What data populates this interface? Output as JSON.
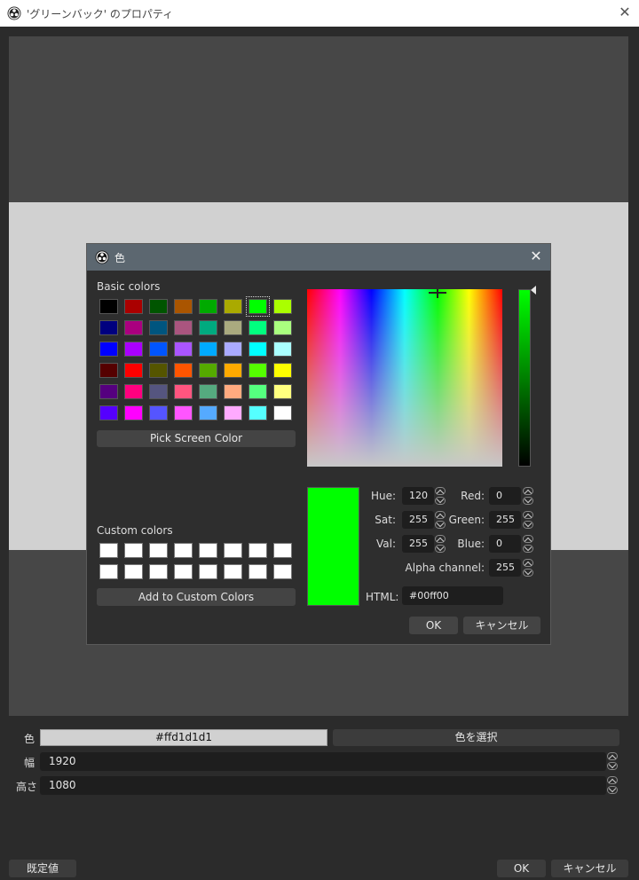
{
  "window": {
    "title": "'グリーンバック' のプロパティ",
    "close": "✕"
  },
  "properties": {
    "color_label": "色",
    "color_value": "#ffd1d1d1",
    "select_color_button": "色を選択",
    "width_label": "幅",
    "width_value": "1920",
    "height_label": "高さ",
    "height_value": "1080"
  },
  "footer": {
    "defaults_button": "既定値",
    "ok_button": "OK",
    "cancel_button": "キャンセル"
  },
  "color_dialog": {
    "title": "色",
    "close": "✕",
    "basic_colors_label": "Basic colors",
    "basic_colors": [
      [
        "#000000",
        "#aa0000",
        "#005500",
        "#aa5500",
        "#00aa00",
        "#aaaa00",
        "#00ff00",
        "#aaff00"
      ],
      [
        "#00007f",
        "#aa007f",
        "#00557f",
        "#aa557f",
        "#00aa7f",
        "#aaaa7f",
        "#00ff7f",
        "#aaff7f"
      ],
      [
        "#0000ff",
        "#aa00ff",
        "#0055ff",
        "#aa55ff",
        "#00aaff",
        "#aaaaff",
        "#00ffff",
        "#aaffff"
      ],
      [
        "#550000",
        "#ff0000",
        "#555500",
        "#ff5500",
        "#55aa00",
        "#ffaa00",
        "#55ff00",
        "#ffff00"
      ],
      [
        "#55007f",
        "#ff007f",
        "#55557f",
        "#ff557f",
        "#55aa7f",
        "#ffaa7f",
        "#55ff7f",
        "#ffff7f"
      ],
      [
        "#5500ff",
        "#ff00ff",
        "#5555ff",
        "#ff55ff",
        "#55aaff",
        "#ffaaff",
        "#55ffff",
        "#ffffff"
      ]
    ],
    "selected_basic": "#00ff00",
    "pick_screen_color_button": "Pick Screen Color",
    "custom_colors_label": "Custom colors",
    "custom_colors_count": 16,
    "add_custom_button": "Add to Custom Colors",
    "current_color": "#00ff00",
    "hue_label": "Hue:",
    "hue_value": "120",
    "sat_label": "Sat:",
    "sat_value": "255",
    "val_label": "Val:",
    "val_value": "255",
    "red_label": "Red:",
    "red_value": "0",
    "green_label": "Green:",
    "green_value": "255",
    "blue_label": "Blue:",
    "blue_value": "0",
    "alpha_label": "Alpha channel:",
    "alpha_value": "255",
    "html_label": "HTML:",
    "html_value": "#00ff00",
    "ok_button": "OK",
    "cancel_button": "キャンセル"
  }
}
